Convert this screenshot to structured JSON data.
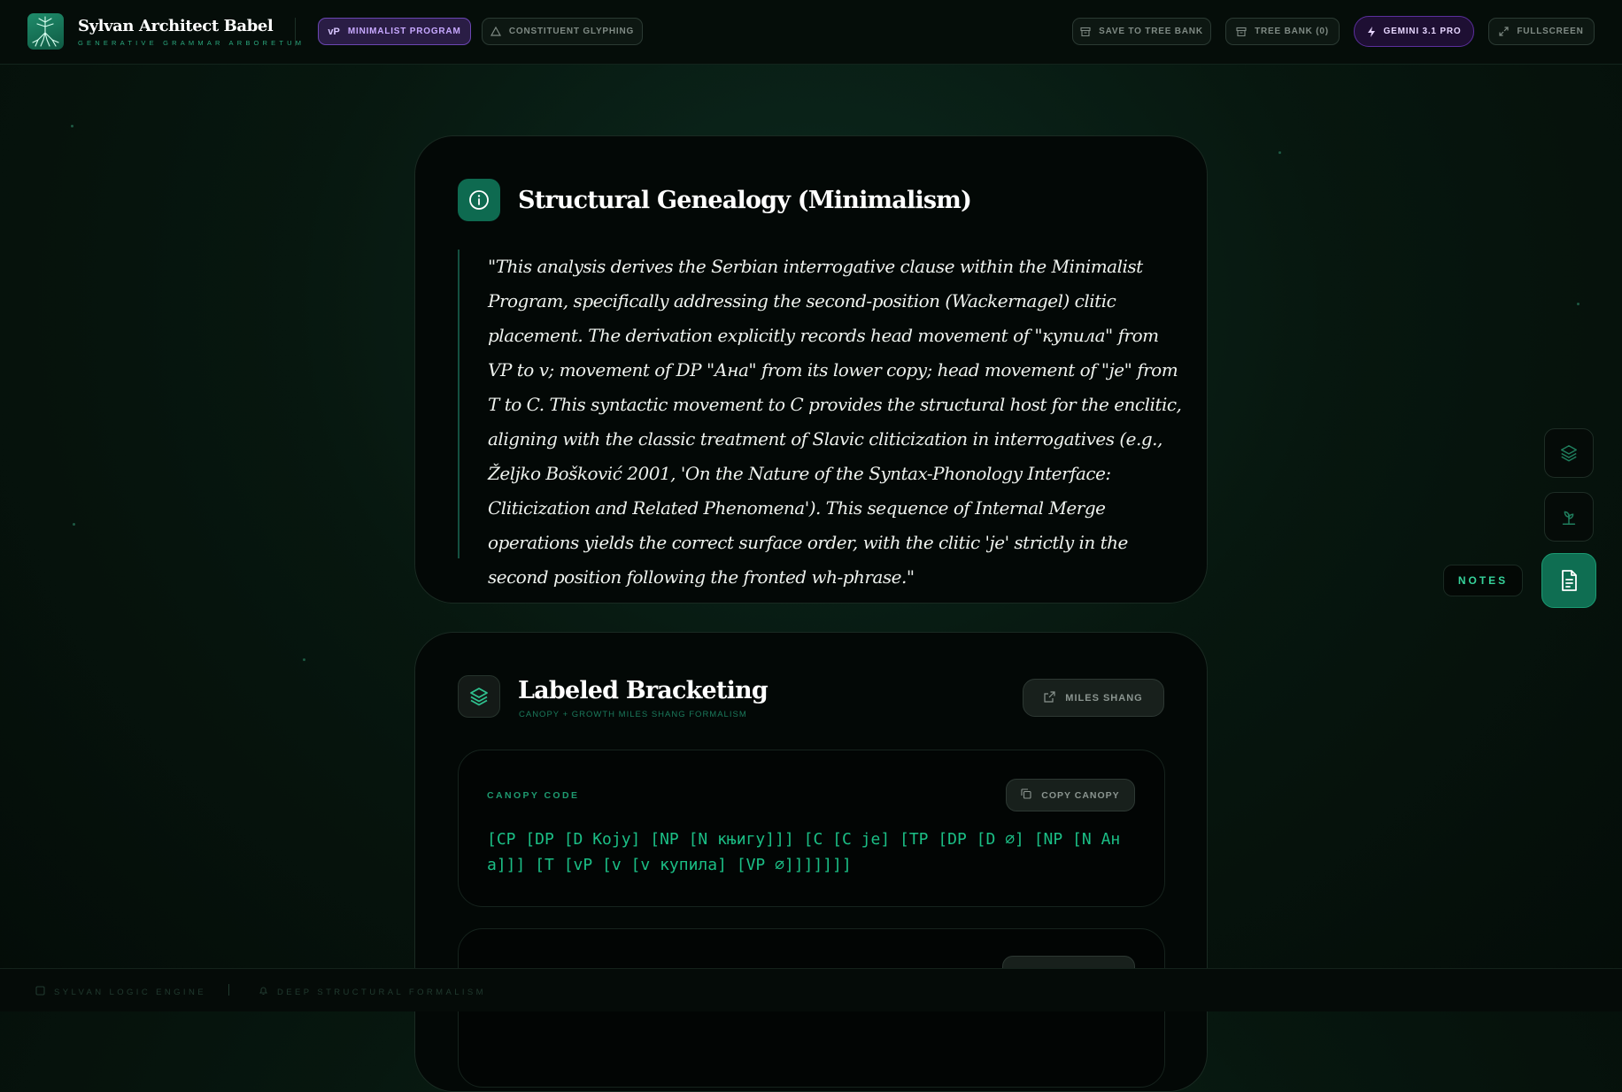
{
  "app": {
    "title": "Sylvan Architect Babel",
    "subtitle": "GENERATIVE GRAMMAR ARBORETUM"
  },
  "toolbar": {
    "mode_tag": "vP",
    "mode_primary": "MINIMALIST PROGRAM",
    "mode_secondary": "CONSTITUENT GLYPHING",
    "save": "SAVE TO TREE BANK",
    "bank": "TREE BANK (0)",
    "model": "GEMINI 3.1 PRO",
    "fullscreen": "FULLSCREEN"
  },
  "genealogy": {
    "title": "Structural Genealogy (Minimalism)",
    "quote": "\"This analysis derives the Serbian interrogative clause within the Minimalist Program, specifically addressing the second-position (Wackernagel) clitic placement. The derivation explicitly records head movement of \"купила\" from VP to v; movement of DP \"Ана\" from its lower copy; head movement of \"je\" from T to C. This syntactic movement to C provides the structural host for the enclitic, aligning with the classic treatment of Slavic cliticization in interrogatives (e.g., Željko Bošković 2001, 'On the Nature of the Syntax-Phonology Interface: Cliticization and Related Phenomena'). This sequence of Internal Merge operations yields the correct surface order, with the clitic 'je' strictly in the second position following the fronted wh-phrase.\""
  },
  "bracketing": {
    "title": "Labeled Bracketing",
    "subtitle": "CANOPY + GROWTH MILES SHANG FORMALISM",
    "miles_button": "MILES SHANG",
    "canopy": {
      "label": "CANOPY CODE",
      "copy_button": "COPY CANOPY",
      "code": "[CP [DP [D Коју] [NP [N књигу]]] [C [C je] [TP [DP [D ∅] [NP [N Ана]]] [T [vP [v [v купила] [VP ∅]]]]]]]"
    }
  },
  "side_dock": {
    "notes_label": "NOTES"
  },
  "footer": {
    "engine": "SYLVAN LOGIC ENGINE",
    "formalism": "DEEP STRUCTURAL FORMALISM"
  },
  "colors": {
    "accent": "#1bbf86",
    "brand_green": "#0e6a50",
    "model_purple": "#6b46b2"
  }
}
